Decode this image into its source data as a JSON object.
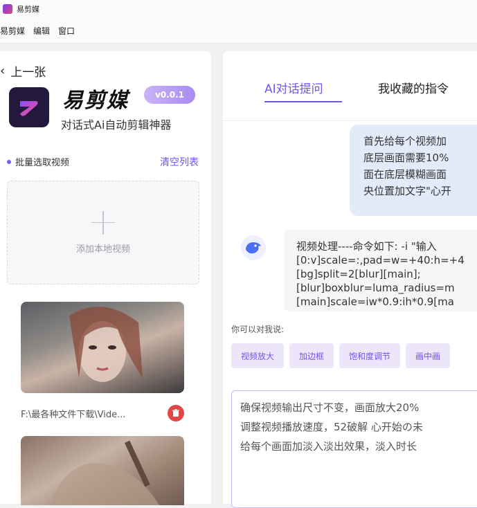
{
  "titlebar": {
    "title": "易剪媒"
  },
  "menu": [
    "易剪媒",
    "编辑",
    "窗口"
  ],
  "left": {
    "prev_label": "上一张",
    "brand": "易剪媒",
    "version": "v0.0.1",
    "slogan": "对话式Ai自动剪辑神器",
    "batch_label": "批量选取视频",
    "clear_label": "清空列表",
    "add_label": "添加本地视频",
    "file_name": "F:\\最各种文件下载\\Vide..."
  },
  "right": {
    "tabs": [
      "AI对话提问",
      "我收藏的指令"
    ],
    "user_message": [
      "首先给每个视频加",
      "底层画面需要10%",
      "面在底层模糊画面",
      "央位置加文字\"心开"
    ],
    "bot_message": [
      "视频处理----命令如下: -i \"输入",
      "[0:v]scale=:,pad=w=+40:h=+4",
      "[bg]split=2[blur][main];",
      "[blur]boxblur=luma_radius=m",
      "[main]scale=iw*0.9:ih*0.9[ma"
    ],
    "suggest_label": "你可以对我说:",
    "chips": [
      "视频放大",
      "加边框",
      "饱和度调节",
      "画中画"
    ],
    "input_lines": [
      "确保视频输出尺寸不变，画面放大20%",
      "调整视频播放速度，52破解 心开始の未",
      "给每个画面加淡入淡出效果，淡入时长"
    ]
  },
  "colors": {
    "accent": "#6f55e8",
    "user_bubble": "#e3ebfb",
    "chip_bg": "#ede6fb",
    "delete": "#e04848"
  },
  "icons": [
    "app-icon",
    "chevron-left-icon",
    "plus-icon",
    "trash-icon",
    "bot-avatar-icon"
  ]
}
